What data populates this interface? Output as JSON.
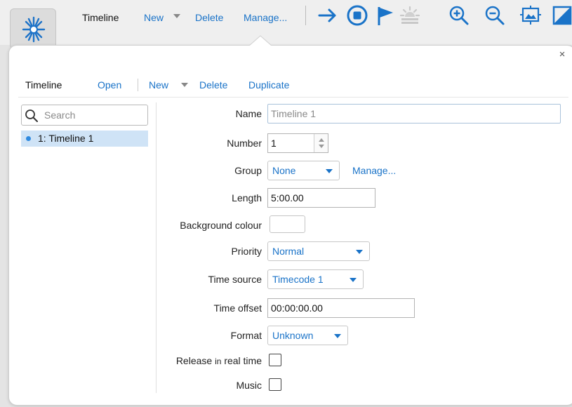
{
  "toolbar": {
    "title": "Timeline",
    "new_label": "New",
    "delete_label": "Delete",
    "manage_label": "Manage...",
    "icons": [
      "arrow-right-icon",
      "stop-circle-icon",
      "flag-icon",
      "sunrise-icon",
      "zoom-in-icon",
      "zoom-out-icon",
      "fit-screen-icon",
      "half-fill-icon"
    ]
  },
  "popover": {
    "close_label": "×",
    "subtoolbar": {
      "title": "Timeline",
      "open_label": "Open",
      "new_label": "New",
      "delete_label": "Delete",
      "duplicate_label": "Duplicate"
    },
    "search": {
      "placeholder": "Search",
      "value": ""
    },
    "list": {
      "items": [
        {
          "label": "1: Timeline 1",
          "selected": true
        }
      ]
    },
    "form": {
      "name_label": "Name",
      "name_value": "Timeline 1",
      "number_label": "Number",
      "number_value": "1",
      "group_label": "Group",
      "group_value": "None",
      "group_manage_label": "Manage...",
      "length_label": "Length",
      "length_value": "5:00.00",
      "background_label": "Background colour",
      "background_color": "#ffffff",
      "priority_label": "Priority",
      "priority_value": "Normal",
      "time_source_label": "Time source",
      "time_source_value": "Timecode 1",
      "time_offset_label": "Time offset",
      "time_offset_value": "00:00:00.00",
      "format_label": "Format",
      "format_value": "Unknown",
      "release_label_a": "Release",
      "release_label_b": "in",
      "release_label_c": "real time",
      "release_checked": false,
      "music_label": "Music",
      "music_checked": false
    }
  },
  "colors": {
    "accent": "#1a73c8",
    "selection": "#cfe3f6",
    "app_icon": "#1e73c8"
  }
}
